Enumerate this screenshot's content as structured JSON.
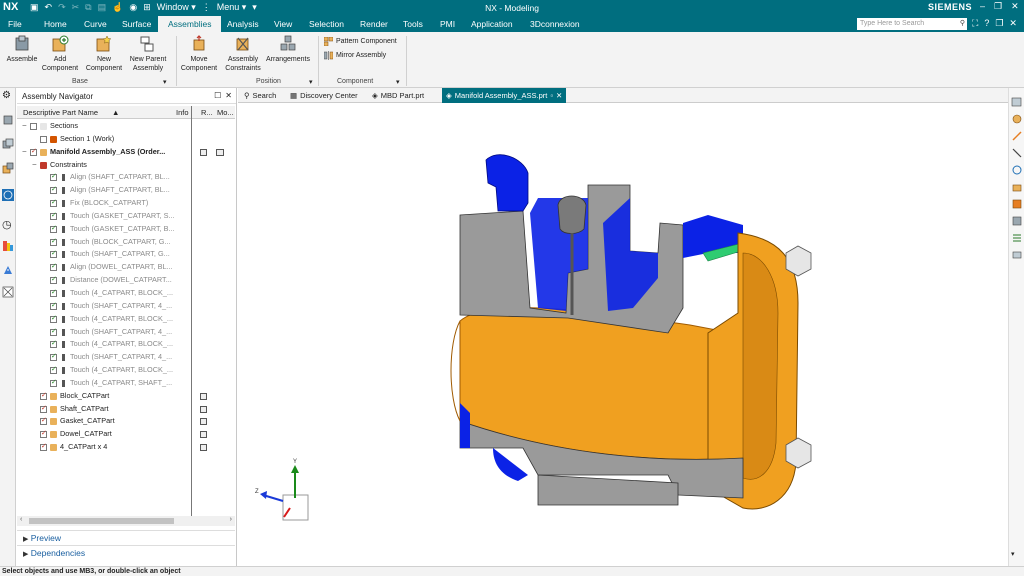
{
  "titlebar": {
    "logo": "NX",
    "window_menu": "Window ▾",
    "menu_menu": "Menu ▾",
    "title": "NX - Modeling",
    "brand": "SIEMENS"
  },
  "menubar": {
    "tabs": [
      "File",
      "Home",
      "Curve",
      "Surface",
      "Assemblies",
      "Analysis",
      "View",
      "Selection",
      "Render",
      "Tools",
      "PMI",
      "Application",
      "3Dconnexion"
    ],
    "active_tab": "Assemblies",
    "search_placeholder": "Type Here to Search"
  },
  "ribbon": {
    "buttons": {
      "assemble": "Assemble",
      "add_component": [
        "Add",
        "Component"
      ],
      "new_component": [
        "New",
        "Component"
      ],
      "new_parent": [
        "New Parent",
        "Assembly"
      ],
      "move_component": [
        "Move",
        "Component"
      ],
      "assembly_constraints": [
        "Assembly",
        "Constraints"
      ],
      "arrangements": "Arrangements",
      "pattern_component": "Pattern Component",
      "mirror_assembly": "Mirror Assembly"
    },
    "groups": {
      "base": "Base",
      "position": "Position",
      "component": "Component"
    }
  },
  "navigator": {
    "title": "Assembly Navigator",
    "columns": {
      "name": "Descriptive Part Name",
      "sort": "▲",
      "info": "Info",
      "r": "R...",
      "mo": "Mo..."
    },
    "rows": [
      {
        "label": "Sections",
        "indent": 0,
        "kind": "folder",
        "grey": false,
        "bold": false
      },
      {
        "label": "Section 1 (Work)",
        "indent": 1,
        "kind": "section",
        "grey": false,
        "bold": false
      },
      {
        "label": "Manifold Assembly_ASS (Order...",
        "indent": 0,
        "kind": "assembly",
        "grey": false,
        "bold": true
      },
      {
        "label": "Constraints",
        "indent": 1,
        "kind": "constraints",
        "grey": false,
        "bold": false
      },
      {
        "label": "Align (SHAFT_CATPART, BL...",
        "indent": 2,
        "kind": "constraint",
        "grey": true
      },
      {
        "label": "Align (SHAFT_CATPART, BL...",
        "indent": 2,
        "kind": "constraint",
        "grey": true
      },
      {
        "label": "Fix (BLOCK_CATPART)",
        "indent": 2,
        "kind": "constraint",
        "grey": true
      },
      {
        "label": "Touch (GASKET_CATPART, S...",
        "indent": 2,
        "kind": "constraint",
        "grey": true
      },
      {
        "label": "Touch (GASKET_CATPART, B...",
        "indent": 2,
        "kind": "constraint",
        "grey": true
      },
      {
        "label": "Touch (BLOCK_CATPART, G...",
        "indent": 2,
        "kind": "constraint",
        "grey": true
      },
      {
        "label": "Touch (SHAFT_CATPART, G...",
        "indent": 2,
        "kind": "constraint",
        "grey": true
      },
      {
        "label": "Align (DOWEL_CATPART, BL...",
        "indent": 2,
        "kind": "constraint",
        "grey": true
      },
      {
        "label": "Distance (DOWEL_CATPART...",
        "indent": 2,
        "kind": "constraint",
        "grey": true
      },
      {
        "label": "Touch (4_CATPART, BLOCK_...",
        "indent": 2,
        "kind": "constraint",
        "grey": true
      },
      {
        "label": "Touch (SHAFT_CATPART, 4_...",
        "indent": 2,
        "kind": "constraint",
        "grey": true
      },
      {
        "label": "Touch (4_CATPART, BLOCK_...",
        "indent": 2,
        "kind": "constraint",
        "grey": true
      },
      {
        "label": "Touch (SHAFT_CATPART, 4_...",
        "indent": 2,
        "kind": "constraint",
        "grey": true
      },
      {
        "label": "Touch (4_CATPART, BLOCK_...",
        "indent": 2,
        "kind": "constraint",
        "grey": true
      },
      {
        "label": "Touch (SHAFT_CATPART, 4_...",
        "indent": 2,
        "kind": "constraint",
        "grey": true
      },
      {
        "label": "Touch (4_CATPART, BLOCK_...",
        "indent": 2,
        "kind": "constraint",
        "grey": true
      },
      {
        "label": "Touch (4_CATPART, SHAFT_...",
        "indent": 2,
        "kind": "constraint",
        "grey": true
      },
      {
        "label": "Block_CATPart",
        "indent": 1,
        "kind": "part",
        "grey": false
      },
      {
        "label": "Shaft_CATPart",
        "indent": 1,
        "kind": "part",
        "grey": false
      },
      {
        "label": "Gasket_CATPart",
        "indent": 1,
        "kind": "part",
        "grey": false
      },
      {
        "label": "Dowel_CATPart",
        "indent": 1,
        "kind": "part",
        "grey": false
      },
      {
        "label": "4_CATPart x 4",
        "indent": 1,
        "kind": "part",
        "grey": false
      }
    ],
    "preview": "Preview",
    "dependencies": "Dependencies"
  },
  "graphics_tabs": [
    {
      "label": "Search",
      "active": false
    },
    {
      "label": "Discovery Center",
      "active": false
    },
    {
      "label": "MBD Part.prt",
      "active": false
    },
    {
      "label": "Manifold Assembly_ASS.prt",
      "active": true
    }
  ],
  "status": "Select objects and use MB3, or double-click an object",
  "colors": {
    "brand_teal": "#006e7f",
    "shaft_orange": "#f0a020",
    "block_grey": "#9a9a9a",
    "section_blue": "#0b22e6"
  }
}
